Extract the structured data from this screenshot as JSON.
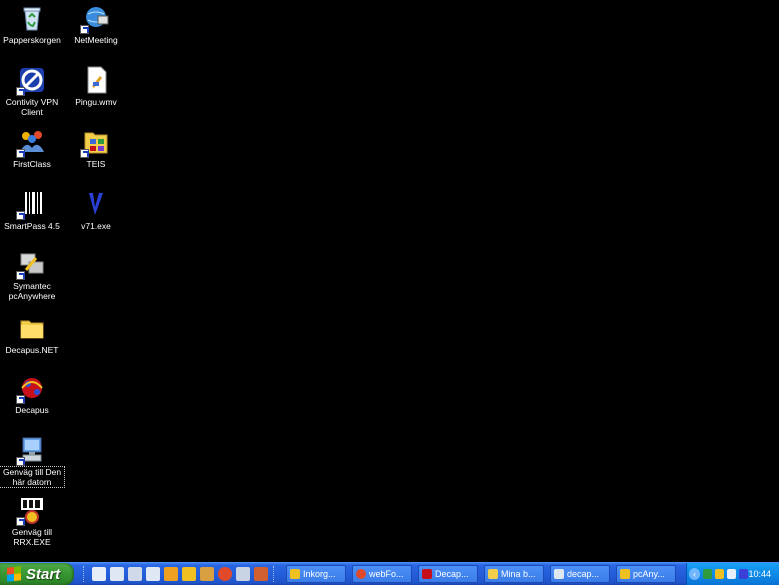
{
  "desktop": {
    "icons": [
      {
        "label": "Papperskorgen",
        "icon": "recycle-bin-icon"
      },
      {
        "label": "NetMeeting",
        "icon": "netmeeting-icon"
      },
      {
        "label": "Contivity VPN Client",
        "icon": "vpn-client-icon"
      },
      {
        "label": "Pingu.wmv",
        "icon": "video-file-icon"
      },
      {
        "label": "FirstClass",
        "icon": "firstclass-icon"
      },
      {
        "label": "TEIS",
        "icon": "folder-apps-icon"
      },
      {
        "label": "SmartPass 4.5",
        "icon": "smartpass-icon"
      },
      {
        "label": "v71.exe",
        "icon": "v71-exe-icon"
      },
      {
        "label": "Symantec pcAnywhere",
        "icon": "pcanywhere-icon"
      },
      {
        "label": "Decapus.NET",
        "icon": "folder-icon"
      },
      {
        "label": "Decapus",
        "icon": "decapus-icon"
      },
      {
        "label": "Genväg till Den här datorn",
        "icon": "my-computer-icon"
      },
      {
        "label": "Genväg till RRX.EXE",
        "icon": "ms-dos-icon"
      }
    ]
  },
  "taskbar": {
    "start_label": "Start",
    "tasks": [
      {
        "label": "Inkorg...",
        "icon": "outlook-icon"
      },
      {
        "label": "webFo...",
        "icon": "firefox-icon"
      },
      {
        "label": "Decap...",
        "icon": "decapus-icon"
      },
      {
        "label": "Mina b...",
        "icon": "folder-icon"
      },
      {
        "label": "decap...",
        "icon": "window-icon"
      },
      {
        "label": "pcAny...",
        "icon": "pcanywhere-icon"
      }
    ],
    "clock": "10:44"
  }
}
